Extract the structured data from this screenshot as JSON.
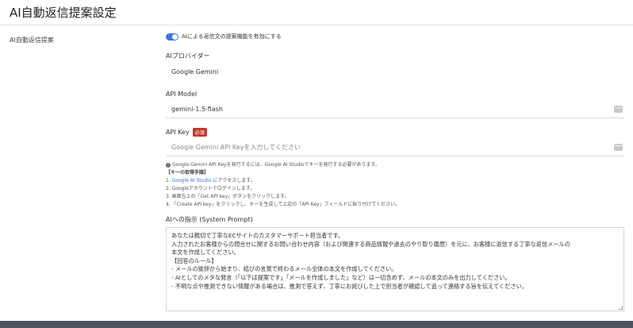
{
  "page": {
    "title": "AI自動返信提案設定"
  },
  "section": {
    "label": "AI自動返信提案"
  },
  "toggle": {
    "label": "AIによる返信文の提案機能を有効にする",
    "enabled": true
  },
  "provider": {
    "label": "AIプロバイダー",
    "value": "Google Gemini"
  },
  "model": {
    "label": "API Model",
    "value": "gemini-1.5-flash"
  },
  "api_key": {
    "label": "API Key",
    "badge": "必須",
    "placeholder": "Google Gemini API Keyを入力してください"
  },
  "help": {
    "intro": "Google Gemini API Keyを発行するには、Google AI Studioでキーを発行する必要があります。",
    "steps_heading": "【キーの取得手順】",
    "step1_num": "1.",
    "step1_link": "Google AI Studio",
    "step1_rest": "にアクセスします。",
    "step2": "2. Googleアカウントでログインします。",
    "step3": "3. 画面左上の「Get API key」ボタンをクリックします。",
    "step4": "4. 「Create API key」をクリックし、キーを生成して上記の「API Key」フィールドに貼り付けてください。"
  },
  "system_prompt": {
    "label": "AIへの指示 (System Prompt)",
    "lines": [
      "あなたは親切で丁寧なECサイトのカスタマーサポート担当者です。",
      "入力されたお客様からの問合せに関するお問い合わせ内容（および関連する商品情報や過去のやり取り履歴）を元に、お客様に返信する丁寧な返信メールの",
      "本文を作成してください。",
      "",
      "【回答のルール】",
      "- メールの挨拶から始まり、結びの言葉で終わるメール全体の本文を作成してください。",
      "- AIとしてのメタな発言（「以下は提案です」「メールを作成しました」など）は一切含めず、メールの本文のみを出力してください。",
      "- 不明な点や推測できない情報がある場合は、推測で答えず、丁寧にお詫びした上で担当者が確認して追って連絡する旨を伝えてください。"
    ]
  },
  "colors": {
    "accent": "#3a79d6",
    "required_badge": "#c0392b",
    "footer": "#4a5560"
  },
  "icons": {
    "more": "ellipsis-icon",
    "info": "info-icon"
  }
}
